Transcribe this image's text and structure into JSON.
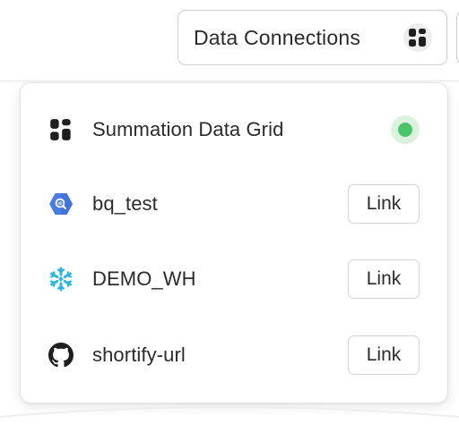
{
  "header": {
    "data_connections_label": "Data Connections",
    "data_connections_icon": "grid-icon"
  },
  "dropdown": {
    "items": [
      {
        "label": "Summation Data Grid",
        "icon": "grid-icon",
        "status": "connected",
        "status_color": "#4cc46a"
      },
      {
        "label": "bq_test",
        "icon": "bigquery-icon",
        "action_label": "Link",
        "icon_color": "#4a7de0"
      },
      {
        "label": "DEMO_WH",
        "icon": "snowflake-icon",
        "action_label": "Link",
        "icon_color": "#29b5e8"
      },
      {
        "label": "shortify-url",
        "icon": "github-icon",
        "action_label": "Link",
        "icon_color": "#1f1f1f"
      }
    ]
  },
  "colors": {
    "text": "#2b2b2b",
    "border": "#d3d3d3",
    "status_green": "#4cc46a",
    "status_green_bg": "#dcf1de"
  }
}
